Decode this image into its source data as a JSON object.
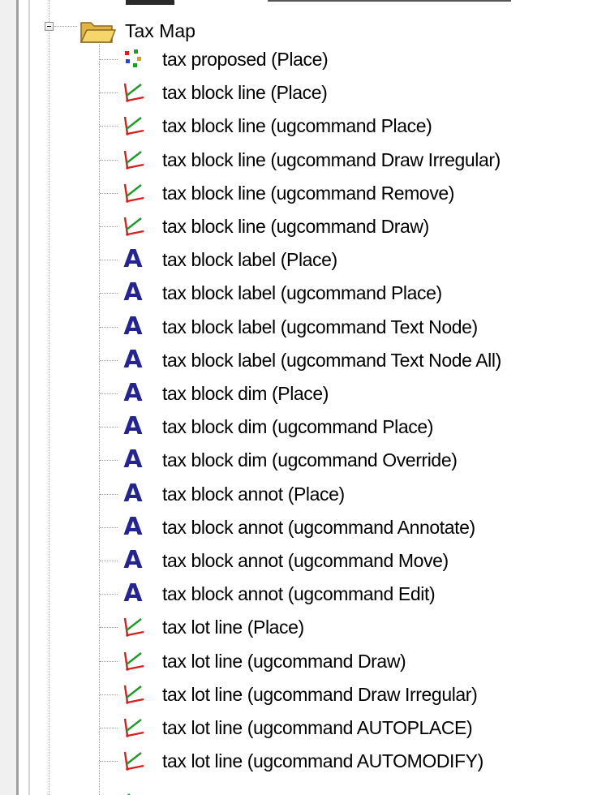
{
  "tree": {
    "group": {
      "label": "Tax Map",
      "icon": "folder-open-icon",
      "expanded": true
    },
    "items": [
      {
        "label": "tax proposed (Place)",
        "icon": "point-feature-icon"
      },
      {
        "label": "tax block line (Place)",
        "icon": "line-feature-icon"
      },
      {
        "label": "tax block line (ugcommand Place)",
        "icon": "line-feature-icon"
      },
      {
        "label": "tax block line (ugcommand Draw Irregular)",
        "icon": "line-feature-icon"
      },
      {
        "label": "tax block line (ugcommand Remove)",
        "icon": "line-feature-icon"
      },
      {
        "label": "tax block line (ugcommand Draw)",
        "icon": "line-feature-icon"
      },
      {
        "label": "tax block label (Place)",
        "icon": "text-feature-icon"
      },
      {
        "label": "tax block label (ugcommand Place)",
        "icon": "text-feature-icon"
      },
      {
        "label": "tax block label (ugcommand Text Node)",
        "icon": "text-feature-icon"
      },
      {
        "label": "tax block label (ugcommand Text Node All)",
        "icon": "text-feature-icon"
      },
      {
        "label": "tax block dim (Place)",
        "icon": "text-feature-icon"
      },
      {
        "label": "tax block dim (ugcommand Place)",
        "icon": "text-feature-icon"
      },
      {
        "label": "tax block dim (ugcommand Override)",
        "icon": "text-feature-icon"
      },
      {
        "label": "tax block annot (Place)",
        "icon": "text-feature-icon"
      },
      {
        "label": "tax block annot (ugcommand Annotate)",
        "icon": "text-feature-icon"
      },
      {
        "label": "tax block annot (ugcommand Move)",
        "icon": "text-feature-icon"
      },
      {
        "label": "tax block annot (ugcommand Edit)",
        "icon": "text-feature-icon"
      },
      {
        "label": "tax lot line (Place)",
        "icon": "line-feature-icon"
      },
      {
        "label": "tax lot line (ugcommand Draw)",
        "icon": "line-feature-icon"
      },
      {
        "label": "tax lot line (ugcommand Draw Irregular)",
        "icon": "line-feature-icon"
      },
      {
        "label": "tax lot line (ugcommand AUTOPLACE)",
        "icon": "line-feature-icon"
      },
      {
        "label": "tax lot line (ugcommand AUTOMODIFY)",
        "icon": "line-feature-icon"
      }
    ]
  },
  "colors": {
    "text_icon": "#25258f",
    "line_icon_green": "#1f9a2a",
    "line_icon_red": "#d42020",
    "folder": "#f2cd5a"
  }
}
